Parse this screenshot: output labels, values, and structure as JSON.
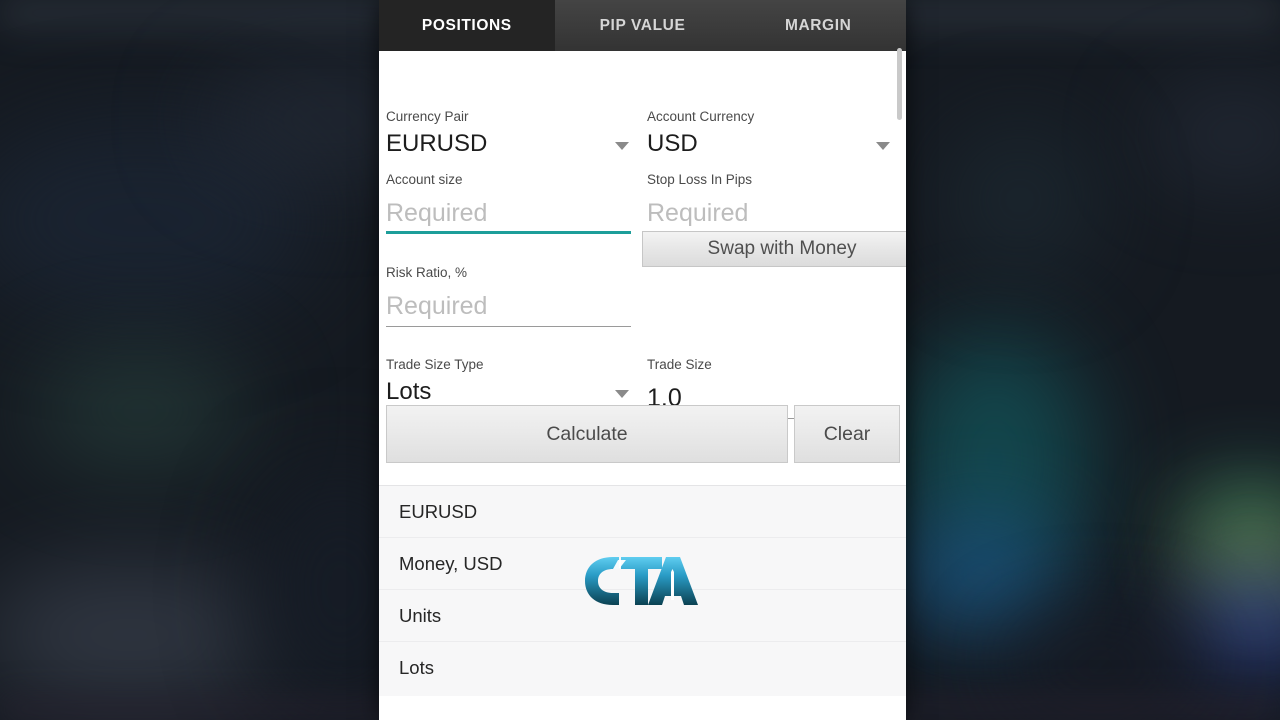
{
  "background": {
    "description": "blurred dark trading chart screen behind modal",
    "base_color": "#151a21",
    "accent_colors": [
      "#1b4a50",
      "#1f5f8f",
      "#3d9a78",
      "#b9a93a",
      "#3a5fd0"
    ]
  },
  "panel": {
    "accent_color": "#1d9e9a",
    "tabs": [
      {
        "label": "POSITIONS",
        "active": true
      },
      {
        "label": "PIP VALUE",
        "active": false
      },
      {
        "label": "MARGIN",
        "active": false
      }
    ],
    "fields": {
      "currency_pair": {
        "label": "Currency Pair",
        "value": "EURUSD",
        "icon": "chevron-down-icon"
      },
      "account_currency": {
        "label": "Account Currency",
        "value": "USD",
        "icon": "chevron-down-icon"
      },
      "account_size": {
        "label": "Account size",
        "placeholder": "Required",
        "value": "",
        "focused": true
      },
      "stop_loss_in_pips": {
        "label": "Stop Loss In Pips",
        "placeholder": "Required",
        "value": "",
        "focused": false
      },
      "risk_ratio": {
        "label": "Risk Ratio, %",
        "placeholder": "Required",
        "value": "",
        "focused": false
      },
      "trade_size_type": {
        "label": "Trade Size Type",
        "value": "Lots",
        "icon": "chevron-down-icon"
      },
      "trade_size": {
        "label": "Trade Size",
        "value": "1.0",
        "placeholder": "",
        "focused": false
      }
    },
    "buttons": {
      "swap": "Swap with Money",
      "calculate": "Calculate",
      "clear": "Clear"
    },
    "results": [
      {
        "label": "EURUSD",
        "value": ""
      },
      {
        "label": "Money, USD",
        "value": ""
      },
      {
        "label": "Units",
        "value": ""
      },
      {
        "label": "Lots",
        "value": ""
      }
    ],
    "watermark": {
      "text": "CTA",
      "color_light": "#4cc2e8",
      "color_dark": "#0d4a5e"
    }
  }
}
